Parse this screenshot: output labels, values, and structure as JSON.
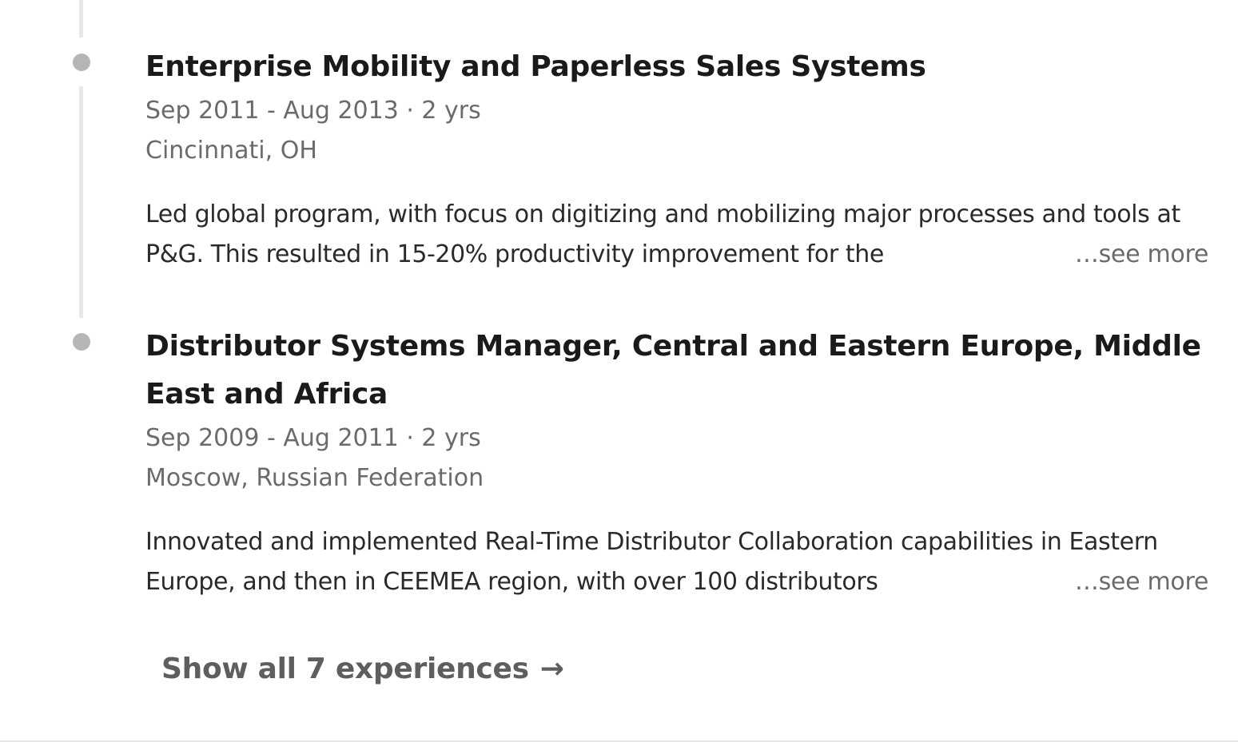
{
  "experiences": [
    {
      "title": "Enterprise Mobility and Paperless Sales Systems",
      "dates": "Sep 2011 - Aug 2013 · 2 yrs",
      "location": "Cincinnati, OH",
      "description": "Led global program, with focus on digitizing and mobilizing major processes and tools at P&G. This resulted in 15-20% productivity improvement for the",
      "see_more": "…see more"
    },
    {
      "title": "Distributor Systems Manager, Central and Eastern Europe, Middle East and Africa",
      "dates": "Sep 2009 - Aug 2011 · 2 yrs",
      "location": "Moscow, Russian Federation",
      "description": "Innovated and implemented Real-Time Distributor Collaboration capabilities in Eastern Europe, and then in CEEMEA region, with over 100 distributors",
      "see_more": "…see more"
    }
  ],
  "show_all": {
    "label": "Show all 7 experiences",
    "icon": "arrow-right-icon",
    "arrow": "→"
  },
  "colors": {
    "title": "#1a1a1a",
    "meta": "#6b6b6b",
    "timeline": "#e8e8e8",
    "dot": "#b5b5b5"
  }
}
